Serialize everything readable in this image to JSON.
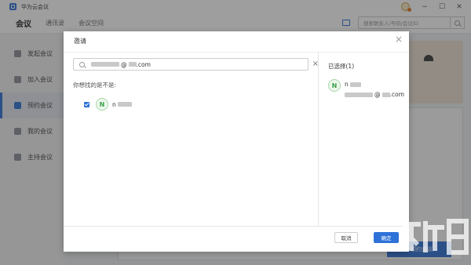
{
  "app": {
    "title": "华为云会议",
    "window_controls": {
      "minimize": "−",
      "maximize": "☐",
      "close": "✕"
    }
  },
  "nav": {
    "tabs": [
      {
        "label": "会议",
        "active": true
      },
      {
        "label": "通讯录",
        "active": false
      },
      {
        "label": "会议空间",
        "active": false
      }
    ],
    "search_placeholder": "搜索联系人/号码/会议ID"
  },
  "sidebar": {
    "items": [
      {
        "label": "发起会议",
        "icon": "start-meeting-icon",
        "active": false
      },
      {
        "label": "加入会议",
        "icon": "join-meeting-icon",
        "active": false
      },
      {
        "label": "预约会议",
        "icon": "schedule-meeting-icon",
        "active": true
      },
      {
        "label": "我的会议",
        "icon": "my-meetings-icon",
        "active": false
      },
      {
        "label": "主持会议",
        "icon": "host-meeting-icon",
        "active": false
      }
    ]
  },
  "background": {
    "cta_label": "预约会议"
  },
  "dialog": {
    "title": "邀请",
    "close": "×",
    "search": {
      "value_prefix": "",
      "value_at": "@",
      "value_suffix": ".com",
      "clear": "×"
    },
    "suggest_label": "你想找的是不是:",
    "suggestion": {
      "avatar_letter": "N",
      "name_prefix": "n",
      "checked": true
    },
    "selected_label": "已选择(1)",
    "selected": {
      "avatar_letter": "N",
      "name_prefix": "n",
      "email_at": "@",
      "email_suffix": ".com"
    },
    "cancel_label": "取消",
    "ok_label": "确定"
  },
  "colors": {
    "accent": "#2e72d8",
    "avatar_green": "#3aa04a"
  }
}
